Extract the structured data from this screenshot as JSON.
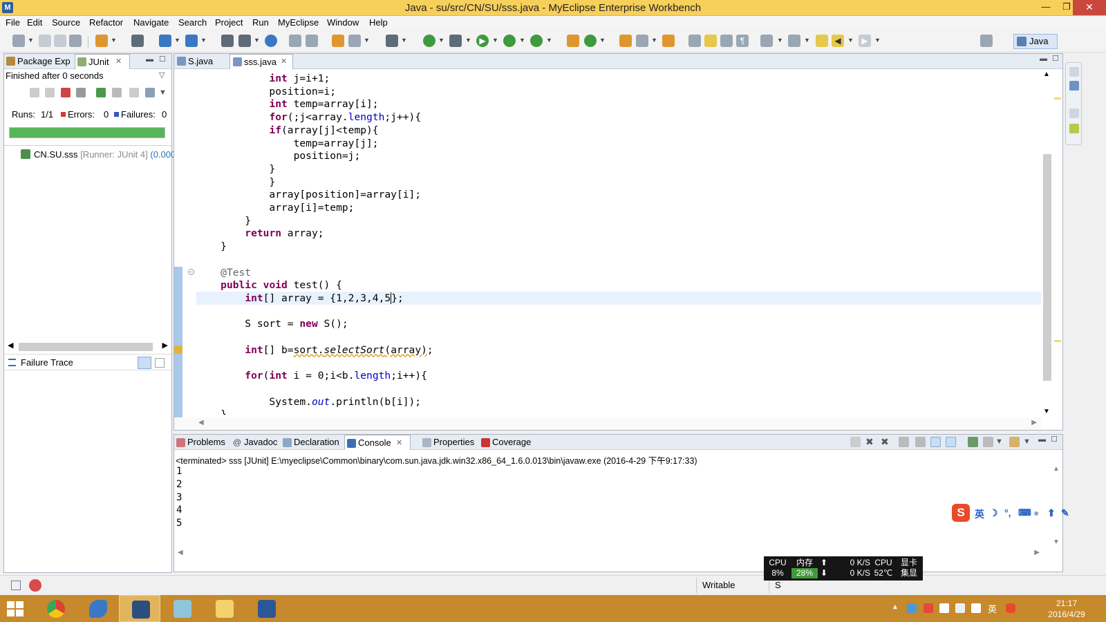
{
  "window": {
    "title": "Java - su/src/CN/SU/sss.java - MyEclipse Enterprise Workbench",
    "minimize": "—",
    "maximize": "❐",
    "close": "✕"
  },
  "menu": [
    "File",
    "Edit",
    "Source",
    "Refactor",
    "Navigate",
    "Search",
    "Project",
    "Run",
    "MyEclipse",
    "Window",
    "Help"
  ],
  "perspective": {
    "label": "Java"
  },
  "left_panel": {
    "tabs": [
      {
        "label": "Package Exp",
        "icon": "package-explorer-icon"
      },
      {
        "label": "JUnit",
        "icon": "junit-icon",
        "active": true
      }
    ],
    "status": "Finished after 0 seconds",
    "runs_label": "Runs:",
    "runs_value": "1/1",
    "errors_label": "Errors:",
    "errors_value": "0",
    "failures_label": "Failures:",
    "failures_value": "0",
    "progress": 1.0,
    "progress_color": "#57b65a",
    "tree_item": {
      "name": "CN.SU.sss",
      "runner": "[Runner: JUnit 4]",
      "time": "(0.000"
    },
    "failure_trace_label": "Failure Trace"
  },
  "editor": {
    "tabs": [
      {
        "label": "S.java",
        "active": false
      },
      {
        "label": "sss.java",
        "active": true
      }
    ]
  },
  "console": {
    "tabs": [
      {
        "label": "Problems",
        "icon": "problems-icon"
      },
      {
        "label": "Javadoc",
        "icon": "javadoc-icon"
      },
      {
        "label": "Declaration",
        "icon": "declaration-icon"
      },
      {
        "label": "Console",
        "icon": "console-icon",
        "active": true
      },
      {
        "label": "Properties",
        "icon": "properties-icon"
      },
      {
        "label": "Coverage",
        "icon": "coverage-icon"
      }
    ],
    "terminated": "<terminated> sss [JUnit] E:\\myeclipse\\Common\\binary\\com.sun.java.jdk.win32.x86_64_1.6.0.013\\bin\\javaw.exe (2016-4-29 下午9:17:33)",
    "output": [
      "1",
      "2",
      "3",
      "4",
      "5"
    ]
  },
  "ime": {
    "logo": "S",
    "lang": "英"
  },
  "statusbar": {
    "writable": "Writable",
    "insert": "S"
  },
  "sysmon": {
    "cpu_label": "CPU",
    "cpu_value": "8%",
    "mem_label": "内存",
    "mem_value": "28%",
    "up_speed": "0 K/S",
    "down_speed": "0 K/S",
    "temp_label": "CPU",
    "temp_value": "52℃",
    "gpu_label": "显卡",
    "gpu_value": "集显"
  },
  "taskbar": {
    "apps": [
      "start-button",
      "chrome",
      "feiq",
      "myeclipse",
      "notepad",
      "file-explorer",
      "word"
    ],
    "tray_lang": "英",
    "time": "21:17",
    "date": "2016/4/29"
  }
}
